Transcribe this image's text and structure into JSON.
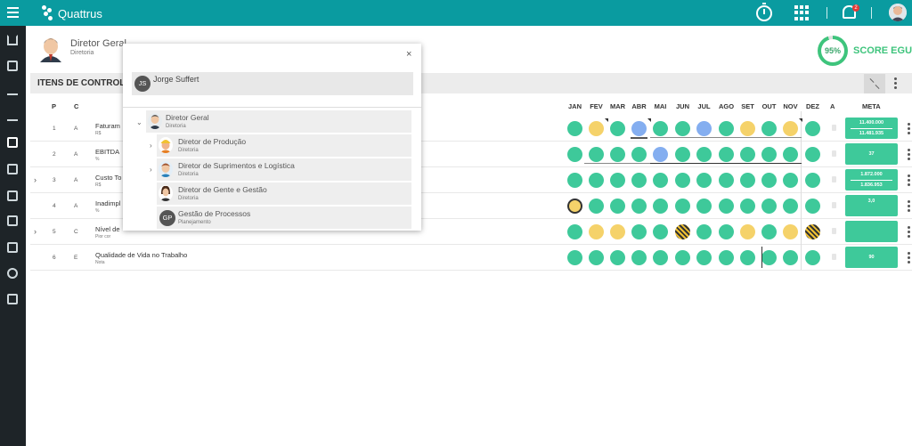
{
  "app": {
    "name": "Quattrus"
  },
  "topbar": {
    "notifications_count": "2",
    "icons": [
      "menu-icon",
      "timer-icon",
      "apps-grid-icon",
      "bell-icon",
      "user-avatar"
    ]
  },
  "sidebar": {
    "icons": [
      "home-icon",
      "dashboard-icon",
      "trend-icon",
      "check-icon",
      "calendar-icon",
      "export-icon",
      "logout-icon",
      "layers-icon",
      "org-chart-icon",
      "globe-icon",
      "report-icon"
    ]
  },
  "header": {
    "title": "Diretor Geral",
    "subtitle": "Diretoria"
  },
  "score": {
    "value": "95%",
    "percent": 95,
    "label": "SCORE EGU"
  },
  "section": {
    "title": "ITENS DE CONTROLE("
  },
  "table": {
    "headers": {
      "p": "P",
      "c": "C",
      "a": "A",
      "meta": "META"
    },
    "months": [
      "JAN",
      "FEV",
      "MAR",
      "ABR",
      "MAI",
      "JUN",
      "JUL",
      "AGO",
      "SET",
      "OUT",
      "NOV",
      "DEZ"
    ],
    "rows": [
      {
        "p": "1",
        "c": "A",
        "name": "Faturam",
        "unit": "R$",
        "expandable": false,
        "status": [
          "green",
          "yellow",
          "green",
          "blue",
          "green",
          "green",
          "blue",
          "green",
          "yellow",
          "green",
          "yellow",
          "green"
        ],
        "meta1": "11.400.000",
        "meta2": "11.481.935"
      },
      {
        "p": "2",
        "c": "A",
        "name": "EBITDA",
        "unit": "%",
        "expandable": false,
        "status": [
          "green",
          "green",
          "green",
          "green",
          "blue",
          "green",
          "green",
          "green",
          "green",
          "green",
          "green",
          "green"
        ],
        "meta1": "37",
        "meta2": ""
      },
      {
        "p": "3",
        "c": "A",
        "name": "Custo To",
        "unit": "R$",
        "expandable": true,
        "status": [
          "green",
          "green",
          "green",
          "green",
          "green",
          "green",
          "green",
          "green",
          "green",
          "green",
          "green",
          "green"
        ],
        "meta1": "1.872.000",
        "meta2": "1.836.953"
      },
      {
        "p": "4",
        "c": "A",
        "name": "Inadimpl",
        "unit": "%",
        "expandable": false,
        "status": [
          "yellow-outline",
          "green",
          "green",
          "green",
          "green",
          "green",
          "green",
          "green",
          "green",
          "green",
          "green",
          "green"
        ],
        "meta1": "3,0",
        "meta2": ""
      },
      {
        "p": "5",
        "c": "C",
        "name": "Nível de",
        "unit": "Pior cor",
        "expandable": true,
        "status": [
          "green",
          "yellow",
          "yellow",
          "green",
          "green",
          "hatch",
          "green",
          "green",
          "yellow",
          "green",
          "yellow",
          "hatch"
        ],
        "meta1": "",
        "meta2": ""
      },
      {
        "p": "6",
        "c": "E",
        "name": "Qualidade de Vida no Trabalho",
        "unit": "Nota",
        "expandable": false,
        "status": [
          "green",
          "green",
          "green",
          "green",
          "green",
          "green",
          "green",
          "green",
          "green",
          "green",
          "green",
          "green"
        ],
        "meta1": "90",
        "meta2": ""
      }
    ]
  },
  "popup": {
    "close": "×",
    "user": {
      "initials": "JS",
      "name": "Jorge Suffert"
    },
    "tree": {
      "root": {
        "name": "Diretor Geral",
        "sub": "Diretoria"
      },
      "children": [
        {
          "name": "Diretor de Produção",
          "sub": "Diretoria",
          "expandable": true
        },
        {
          "name": "Diretor de Suprimentos e Logística",
          "sub": "Diretoria",
          "expandable": true
        },
        {
          "name": "Diretor de Gente e Gestão",
          "sub": "Diretoria",
          "expandable": false
        },
        {
          "name": "Gestão de Processos",
          "sub": "Planejamento",
          "expandable": false,
          "initials": "GP"
        }
      ]
    }
  }
}
